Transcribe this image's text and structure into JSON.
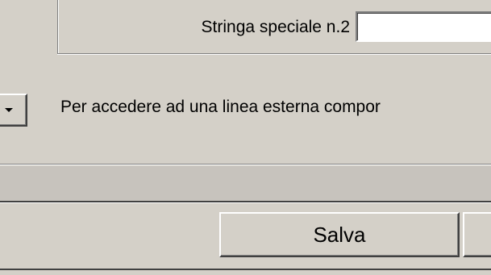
{
  "special_string": {
    "label": "Stringa speciale n.2",
    "value": ""
  },
  "info": {
    "text": "Per accedere ad una linea esterna compor"
  },
  "buttons": {
    "save_label": "Salva",
    "next_label": ""
  },
  "icons": {
    "dropdown": "chevron-down-icon"
  }
}
